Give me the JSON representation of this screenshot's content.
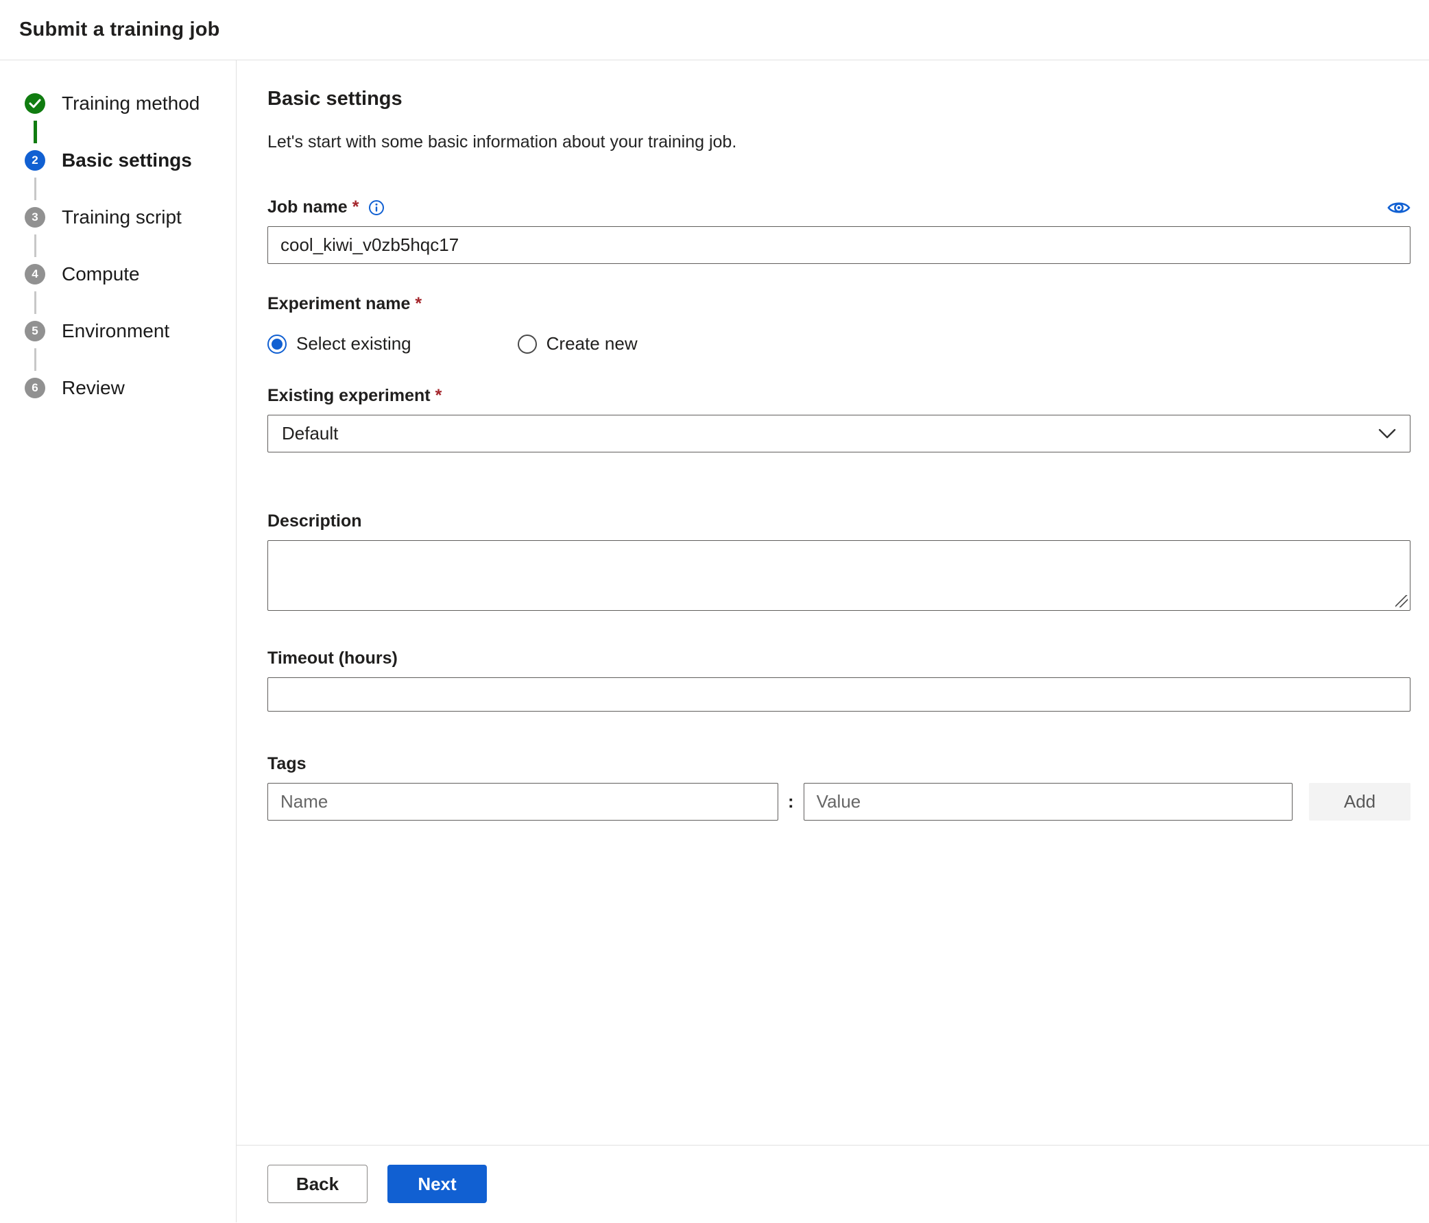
{
  "colors": {
    "accent": "#1160d2",
    "completed_green": "#107c10",
    "upcoming_gray": "#919191",
    "required_red": "#a4262c",
    "input_border": "#605e5c",
    "divider": "#e0e0e0",
    "add_button_bg": "#f3f3f3"
  },
  "header": {
    "title": "Submit a training job"
  },
  "wizard": {
    "steps": [
      {
        "label": "Training method",
        "state": "completed"
      },
      {
        "label": "Basic settings",
        "state": "current",
        "number": "2"
      },
      {
        "label": "Training script",
        "state": "upcoming",
        "number": "3"
      },
      {
        "label": "Compute",
        "state": "upcoming",
        "number": "4"
      },
      {
        "label": "Environment",
        "state": "upcoming",
        "number": "5"
      },
      {
        "label": "Review",
        "state": "upcoming",
        "number": "6"
      }
    ]
  },
  "main": {
    "heading": "Basic settings",
    "subtitle": "Let's start with some basic information about your training job.",
    "required_marker": "*",
    "job_name": {
      "label": "Job name",
      "value": "cool_kiwi_v0zb5hqc17"
    },
    "experiment": {
      "label": "Experiment name",
      "options": [
        {
          "label": "Select existing",
          "selected": true
        },
        {
          "label": "Create new",
          "selected": false
        }
      ]
    },
    "existing_experiment": {
      "label": "Existing experiment",
      "value": "Default"
    },
    "description": {
      "label": "Description",
      "value": ""
    },
    "timeout": {
      "label": "Timeout (hours)",
      "value": ""
    },
    "tags": {
      "label": "Tags",
      "name_placeholder": "Name",
      "value_placeholder": "Value",
      "separator": ":",
      "add_label": "Add"
    }
  },
  "footer": {
    "back_label": "Back",
    "next_label": "Next"
  }
}
